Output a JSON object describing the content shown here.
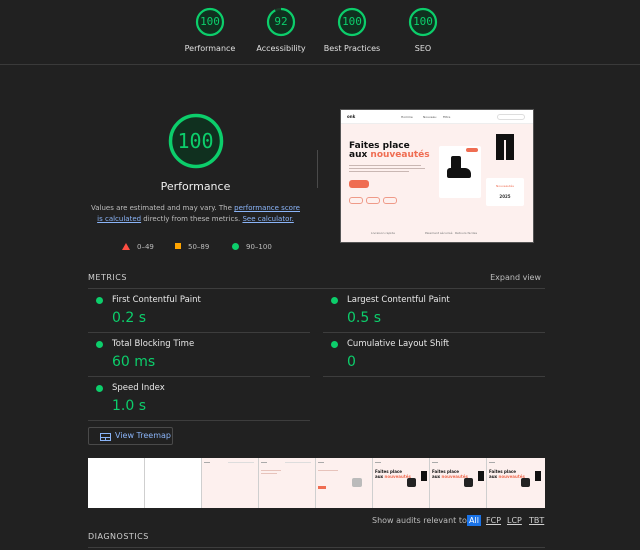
{
  "top_scores": [
    {
      "label": "Performance",
      "score": "100",
      "value": 100
    },
    {
      "label": "Accessibility",
      "score": "92",
      "value": 92
    },
    {
      "label": "Best Practices",
      "score": "100",
      "value": 100
    },
    {
      "label": "SEO",
      "score": "100",
      "value": 100
    }
  ],
  "colors": {
    "pass": "#0cce6b",
    "average": "#ffa400",
    "fail": "#ff4e42",
    "link": "#8ab4f8",
    "accent": "#ef6d52"
  },
  "performance": {
    "score": "100",
    "value": 100,
    "title": "Performance",
    "desc_pre": "Values are estimated and may vary. The ",
    "desc_link1": "performance score is calculated",
    "desc_mid": " directly from these metrics. ",
    "desc_link2": "See calculator.",
    "legend": {
      "fail": "0–49",
      "average": "50–89",
      "pass": "90–100"
    }
  },
  "preview": {
    "logo": "onk",
    "nav": [
      "Homme",
      "Nouveau",
      "Filtre"
    ],
    "headline_1": "Faites place",
    "headline_2a": "aux ",
    "headline_2b": "nouveautés",
    "badge_year": "2025",
    "card_label": "Nouveautés",
    "features": [
      "Livraison rapide",
      "Paiement sécurisé",
      "Retours faciles"
    ]
  },
  "metrics": {
    "title": "METRICS",
    "expand": "Expand view",
    "items": [
      {
        "name": "First Contentful Paint",
        "value": "0.2 s"
      },
      {
        "name": "Largest Contentful Paint",
        "value": "0.5 s"
      },
      {
        "name": "Total Blocking Time",
        "value": "60 ms"
      },
      {
        "name": "Cumulative Layout Shift",
        "value": "0"
      },
      {
        "name": "Speed Index",
        "value": "1.0 s"
      }
    ]
  },
  "treemap": {
    "label": "View Treemap",
    "icon": "treemap-icon"
  },
  "audits_filter": {
    "label": "Show audits relevant to:",
    "chips": [
      "All",
      "FCP",
      "LCP",
      "TBT"
    ],
    "active": "All"
  },
  "diagnostics": {
    "title": "DIAGNOSTICS"
  }
}
